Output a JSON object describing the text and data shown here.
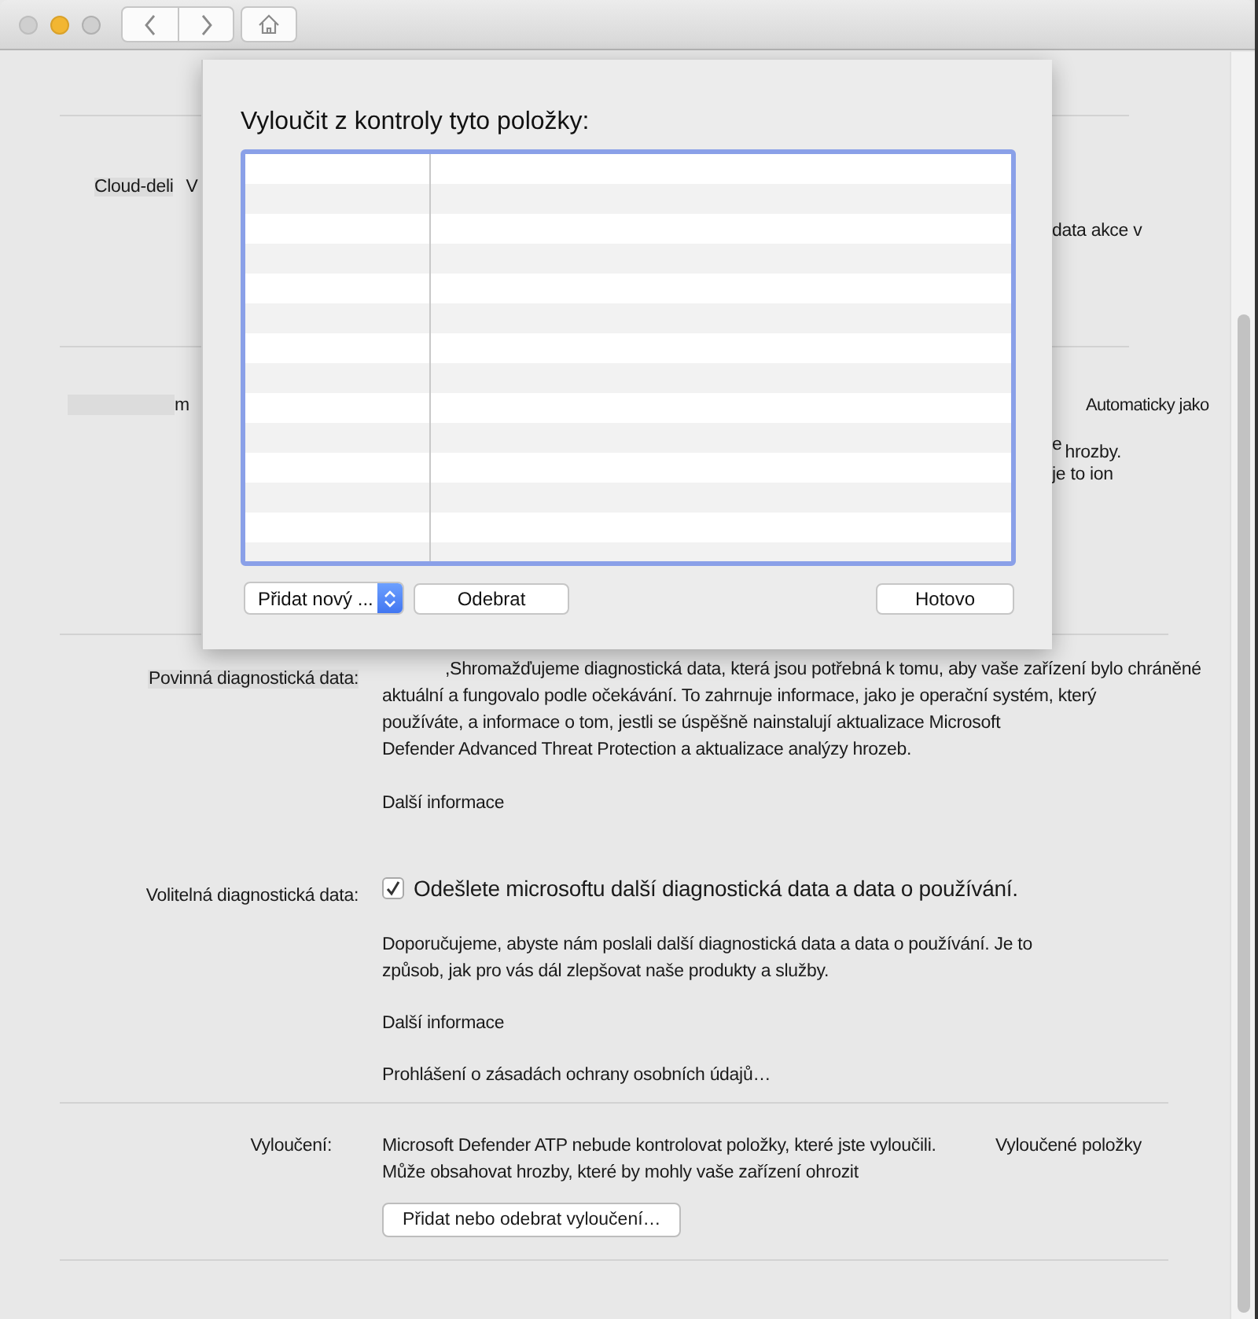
{
  "window": {
    "traffic_lights": [
      {
        "kind": "close",
        "color": "#cfcfcf"
      },
      {
        "kind": "minimize",
        "color": "#f2b632"
      },
      {
        "kind": "zoom",
        "color": "#cfcfcf"
      }
    ],
    "nav_buttons": [
      {
        "kind": "back"
      },
      {
        "kind": "forward"
      }
    ]
  },
  "cloud_section": {
    "label": "Cloud-deli",
    "label_rest": "V",
    "note": "data akce v"
  },
  "automatic_section": {
    "label_rest": "m",
    "heading": "Automaticky jako",
    "note_start": "e",
    "note_line_1": "hrozby.",
    "note_line_2": "je to ion"
  },
  "sheet": {
    "title": "Vyloučit z kontroly tyto položky:",
    "add_popup": "Přidat nový ...",
    "buttons": [
      {
        "kind": "remove",
        "label": "Odebrat"
      },
      {
        "kind": "done",
        "label": "Hotovo"
      }
    ]
  },
  "mandatory_data": {
    "label": "Povinná diagnostická data:",
    "text": ",Shromažďujeme diagnostická data, která jsou potřebná k tomu, aby vaše zařízení bylo chráněné\naktuální a fungovalo podle očekávání. To zahrnuje informace, jako je operační systém, který\npoužíváte, a informace o tom, jestli se úspěšně nainstalují aktualizace Microsoft\nDefender Advanced Threat Protection a aktualizace analýzy hrozeb.",
    "more_link": "Další informace"
  },
  "optional_data": {
    "label": "Volitelná diagnostická data:",
    "checkbox": {
      "label": "Odešlete microsoftu další diagnostická data a data o používání.",
      "checked": true
    },
    "text": "Doporučujeme, abyste nám poslali další diagnostická data a data o používání. Je to\nzpůsob, jak pro vás dál zlepšovat naše produkty a služby.",
    "more_link": "Další informace",
    "privacy_link": "Prohlášení o zásadách ochrany osobních údajů…"
  },
  "exclusions": {
    "label": "Vyloučení:",
    "line_1": "Microsoft Defender ATP nebude kontrolovat položky, které jste vyloučili.",
    "line_2": "Může obsahovat hrozby, které by mohly vaše zařízení ohrozit",
    "side_label": "Vyloučené položky",
    "button": "Přidat nebo odebrat vyloučení…"
  }
}
